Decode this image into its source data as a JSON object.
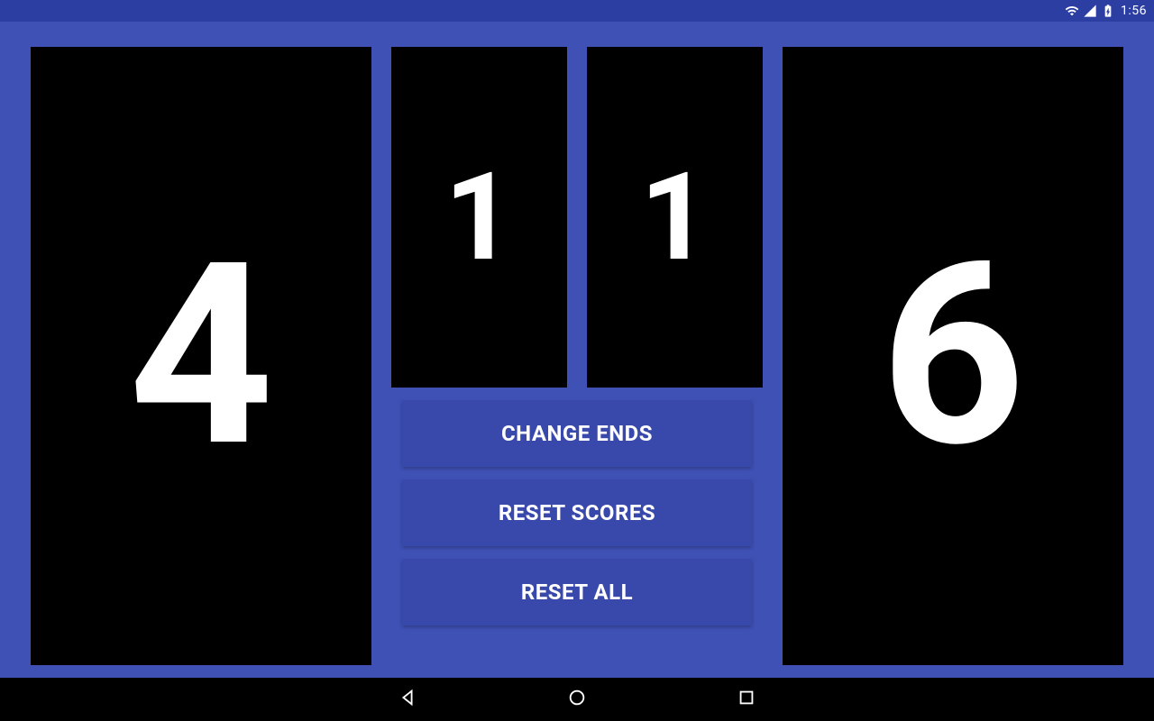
{
  "status": {
    "time": "1:56"
  },
  "scores": {
    "left_points": "4",
    "right_points": "6",
    "left_sets": "1",
    "right_sets": "1"
  },
  "buttons": {
    "change_ends": "CHANGE ENDS",
    "reset_scores": "RESET SCORES",
    "reset_all": "RESET ALL"
  }
}
